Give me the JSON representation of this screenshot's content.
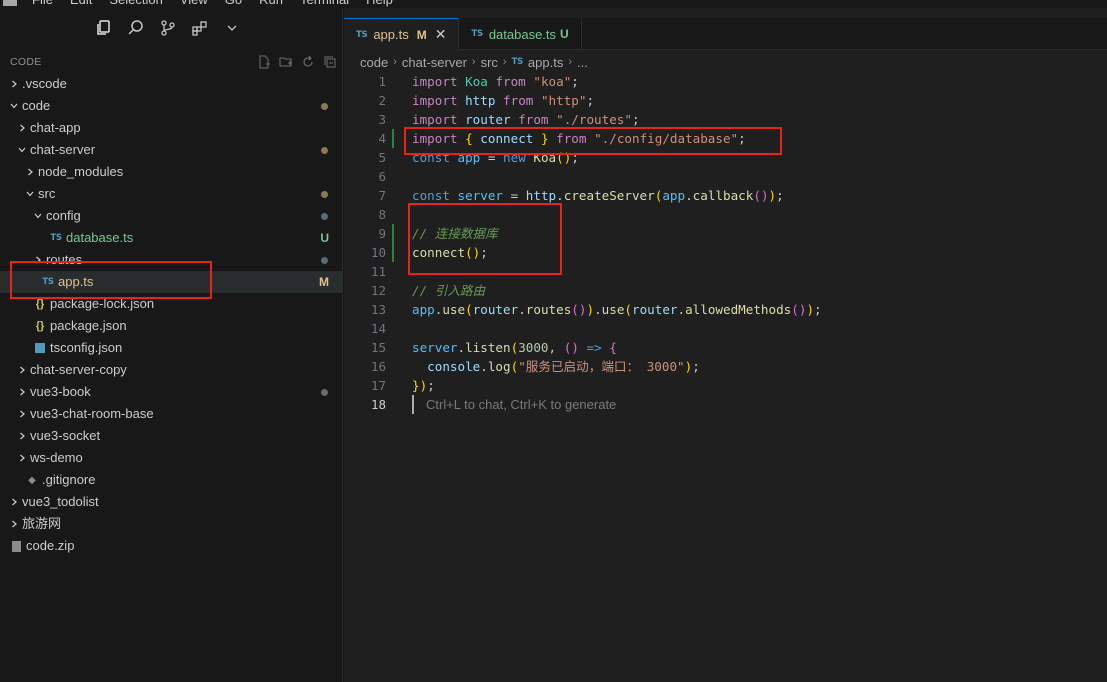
{
  "menu": {
    "items": [
      "File",
      "Edit",
      "Selection",
      "View",
      "Go",
      "Run",
      "Terminal",
      "Help"
    ]
  },
  "activity_icons": [
    "files-icon",
    "search-icon",
    "source-control-icon",
    "extensions-icon",
    "chevron-down-icon"
  ],
  "explorer": {
    "title": "CODE",
    "action_icons": [
      "new-file-icon",
      "new-folder-icon",
      "refresh-icon",
      "collapse-all-icon"
    ],
    "tree": [
      {
        "label": ".vscode",
        "type": "folder",
        "open": false,
        "depth": 0
      },
      {
        "label": "code",
        "type": "folder",
        "open": true,
        "depth": 0,
        "status": "dot"
      },
      {
        "label": "chat-app",
        "type": "folder",
        "open": false,
        "depth": 1
      },
      {
        "label": "chat-server",
        "type": "folder",
        "open": true,
        "depth": 1,
        "status": "dot"
      },
      {
        "label": "node_modules",
        "type": "folder",
        "open": false,
        "depth": 2
      },
      {
        "label": "src",
        "type": "folder",
        "open": true,
        "depth": 2,
        "status": "dot"
      },
      {
        "label": "config",
        "type": "folder",
        "open": true,
        "depth": 3,
        "status": "dot-blue"
      },
      {
        "label": "database.ts",
        "type": "ts",
        "depth": 4,
        "status": "U"
      },
      {
        "label": "routes",
        "type": "folder",
        "open": false,
        "depth": 3,
        "status": "dot-blue"
      },
      {
        "label": "app.ts",
        "type": "ts",
        "depth": 3,
        "status": "M",
        "selected": true
      },
      {
        "label": "package-lock.json",
        "type": "json",
        "depth": 2
      },
      {
        "label": "package.json",
        "type": "json",
        "depth": 2
      },
      {
        "label": "tsconfig.json",
        "type": "tsconfig",
        "depth": 2
      },
      {
        "label": "chat-server-copy",
        "type": "folder",
        "open": false,
        "depth": 1
      },
      {
        "label": "vue3-book",
        "type": "folder",
        "open": false,
        "depth": 1,
        "status": "dot-gray"
      },
      {
        "label": "vue3-chat-room-base",
        "type": "folder",
        "open": false,
        "depth": 1
      },
      {
        "label": "vue3-socket",
        "type": "folder",
        "open": false,
        "depth": 1
      },
      {
        "label": "ws-demo",
        "type": "folder",
        "open": false,
        "depth": 1
      },
      {
        "label": ".gitignore",
        "type": "git",
        "depth": 1
      },
      {
        "label": "vue3_todolist",
        "type": "folder",
        "open": false,
        "depth": 0
      },
      {
        "label": "旅游网",
        "type": "folder",
        "open": false,
        "depth": 0
      },
      {
        "label": "code.zip",
        "type": "zip",
        "depth": 0
      }
    ]
  },
  "tabs": [
    {
      "icon": "TS",
      "name": "app.ts",
      "status": "M",
      "active": true,
      "close": "✕"
    },
    {
      "icon": "TS",
      "name": "database.ts",
      "status": "U",
      "active": false
    }
  ],
  "breadcrumb": {
    "parts": [
      "code",
      "chat-server",
      "src"
    ],
    "file_icon": "TS",
    "file": "app.ts",
    "tail": "..."
  },
  "editor": {
    "current_line": 18,
    "hint": "Ctrl+L to chat, Ctrl+K to generate",
    "lines": [
      {
        "n": 1,
        "text": "import Koa from \"koa\";"
      },
      {
        "n": 2,
        "text": "import http from \"http\";"
      },
      {
        "n": 3,
        "text": "import router from \"./routes\";"
      },
      {
        "n": 4,
        "text": "import { connect } from \"./config/database\";"
      },
      {
        "n": 5,
        "text": "const app = new Koa();"
      },
      {
        "n": 6,
        "text": ""
      },
      {
        "n": 7,
        "text": "const server = http.createServer(app.callback());"
      },
      {
        "n": 8,
        "text": ""
      },
      {
        "n": 9,
        "text": "// 连接数据库"
      },
      {
        "n": 10,
        "text": "connect();"
      },
      {
        "n": 11,
        "text": ""
      },
      {
        "n": 12,
        "text": "// 引入路由"
      },
      {
        "n": 13,
        "text": "app.use(router.routes()).use(router.allowedMethods());"
      },
      {
        "n": 14,
        "text": ""
      },
      {
        "n": 15,
        "text": "server.listen(3000, () => {"
      },
      {
        "n": 16,
        "text": "  console.log(\"服务已启动，端口： 3000\");"
      },
      {
        "n": 17,
        "text": "});"
      },
      {
        "n": 18,
        "text": ""
      }
    ]
  },
  "colors": {
    "accent": "#0078d4",
    "modified": "#e2c08d",
    "untracked": "#73c991",
    "annotation": "#e5251b"
  }
}
